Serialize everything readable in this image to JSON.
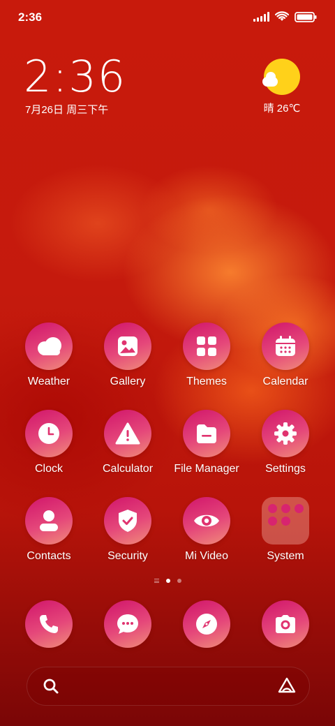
{
  "status_bar": {
    "time": "2:36",
    "icons": [
      "signal-icon",
      "wifi-icon",
      "battery-icon"
    ]
  },
  "clock_widget": {
    "time": "2:36",
    "date": "7月26日 周三下午"
  },
  "weather_widget": {
    "condition_icon": "sun-cloud-icon",
    "text": "晴 26℃"
  },
  "apps": [
    {
      "label": "Weather",
      "icon": "cloud-icon"
    },
    {
      "label": "Gallery",
      "icon": "image-icon"
    },
    {
      "label": "Themes",
      "icon": "grid-icon"
    },
    {
      "label": "Calendar",
      "icon": "calendar-icon"
    },
    {
      "label": "Clock",
      "icon": "clock-icon"
    },
    {
      "label": "Calculator",
      "icon": "warning-icon"
    },
    {
      "label": "File Manager",
      "icon": "folder-icon"
    },
    {
      "label": "Settings",
      "icon": "gear-icon"
    },
    {
      "label": "Contacts",
      "icon": "person-icon"
    },
    {
      "label": "Security",
      "icon": "shield-icon"
    },
    {
      "label": "Mi Video",
      "icon": "eye-icon"
    },
    {
      "label": "System",
      "icon": "folder-group-icon"
    }
  ],
  "page_indicator": {
    "pages": 2,
    "current": 1
  },
  "dock": [
    {
      "icon": "phone-icon"
    },
    {
      "icon": "message-icon"
    },
    {
      "icon": "compass-icon"
    },
    {
      "icon": "camera-icon"
    }
  ],
  "search_bar": {
    "left_icon": "search-icon",
    "right_icon": "assistant-icon"
  },
  "colors": {
    "icon_gradient_start": "#d1156b",
    "icon_gradient_end": "#f08d7a",
    "weather_sun": "#ffd11a"
  }
}
